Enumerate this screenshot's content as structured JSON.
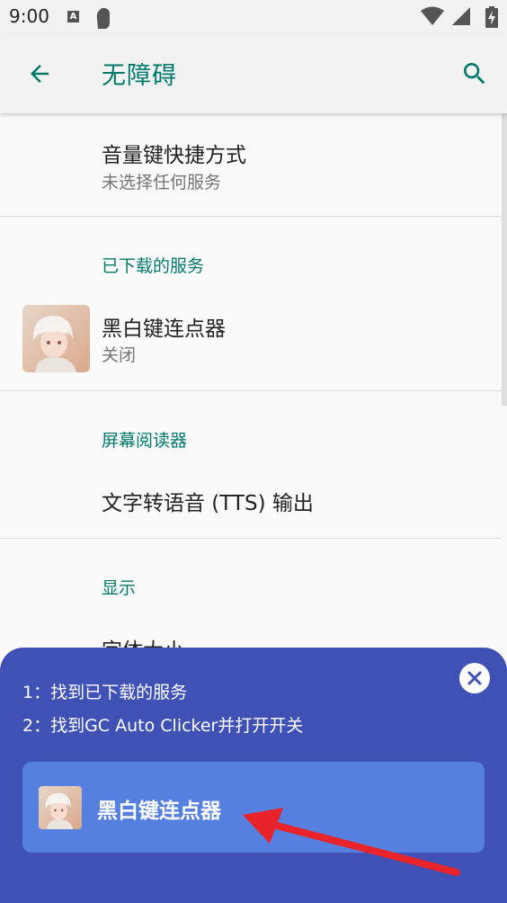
{
  "status_bar": {
    "time": "9:00",
    "notification_letter": "A"
  },
  "app_bar": {
    "title": "无障碍"
  },
  "items": {
    "volume_shortcut": {
      "title": "音量键快捷方式",
      "summary": "未选择任何服务"
    },
    "downloaded_services_header": "已下载的服务",
    "downloaded_app": {
      "title": "黑白键连点器",
      "summary": "关闭"
    },
    "screen_reader_header": "屏幕阅读器",
    "tts_output": {
      "title": "文字转语音 (TTS) 输出"
    },
    "display_header": "显示",
    "font_size": {
      "title": "字体大小"
    }
  },
  "guide": {
    "step1": "1：找到已下载的服务",
    "step2": "2：找到GC Auto Clicker并打开开关",
    "card_label": "黑白键连点器"
  },
  "colors": {
    "accent": "#00796b",
    "sheet_bg": "#3f51b5",
    "card_bg": "#5580e0",
    "arrow": "#e8232a"
  }
}
